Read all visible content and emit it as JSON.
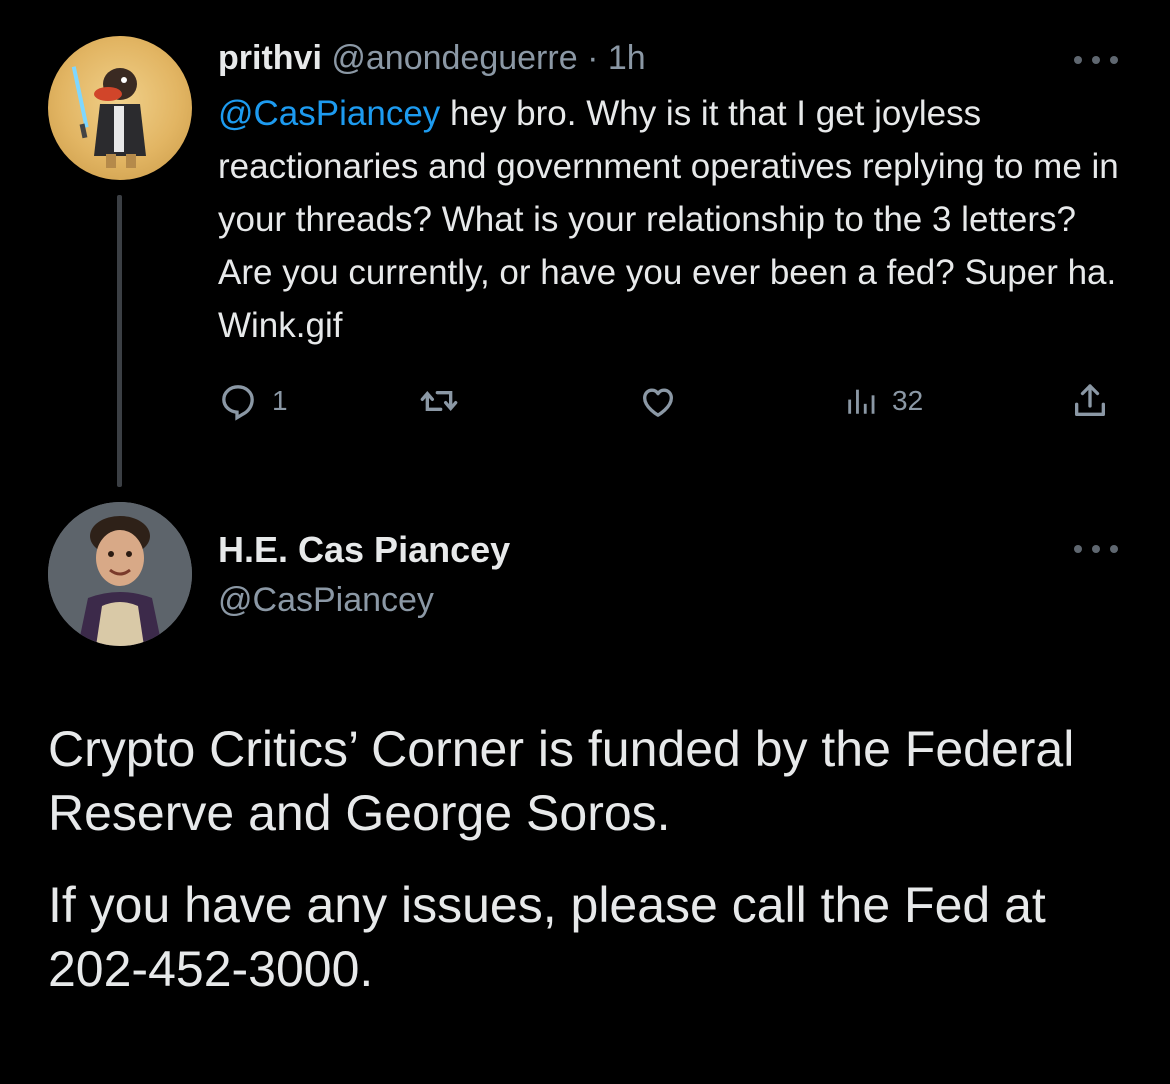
{
  "reply": {
    "author_name": "prithvi",
    "author_handle": "@anondeguerre",
    "separator": " · ",
    "time": "1h",
    "mention": "@CasPiancey",
    "text": " hey bro. Why is it that I get joyless reactionaries and government operatives replying to me in your threads? What is your relationship to the 3 letters? Are you currently, or have you ever been a fed? Super ha. Wink.gif",
    "reply_count": "1",
    "views_count": "32",
    "icons": {
      "reply": "reply-icon",
      "retweet": "retweet-icon",
      "like": "heart-icon",
      "views": "views-icon",
      "share": "share-icon",
      "more": "more-icon"
    }
  },
  "main_tweet": {
    "author_name": "H.E. Cas Piancey",
    "author_handle": "@CasPiancey",
    "paragraph_1": "Crypto Critics’ Corner is funded by the Federal Reserve and George Soros.",
    "paragraph_2": "If you have any issues, please call the Fed at 202-452-3000."
  },
  "colors": {
    "background": "#000000",
    "text": "#e7e9ea",
    "muted": "#8b98a5",
    "link": "#1d9bf0"
  }
}
